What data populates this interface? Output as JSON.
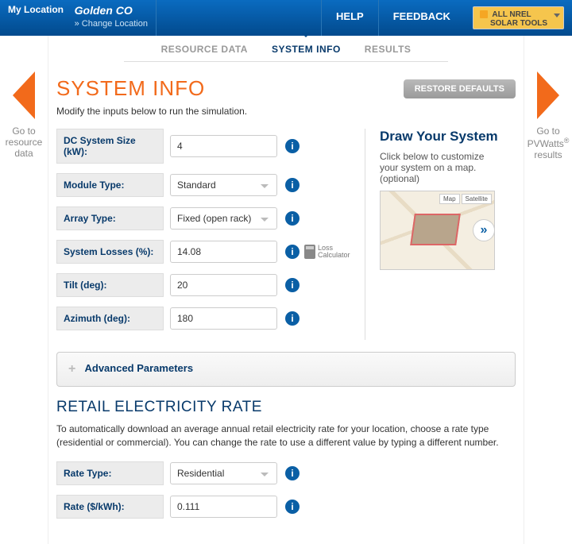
{
  "header": {
    "my_location_label": "My Location",
    "location_value": "Golden CO",
    "change_location": "» Change Location",
    "help": "HELP",
    "feedback": "FEEDBACK",
    "tools_line1": "ALL NREL",
    "tools_line2": "SOLAR TOOLS"
  },
  "tabs": {
    "resource": "RESOURCE DATA",
    "system": "SYSTEM INFO",
    "results": "RESULTS"
  },
  "nav": {
    "left_label1": "Go to",
    "left_label2": "resource",
    "left_label3": "data",
    "right_label1": "Go to",
    "right_label2": "PVWatts",
    "right_label3": "results"
  },
  "page": {
    "title": "SYSTEM INFO",
    "restore": "RESTORE DEFAULTS",
    "subtitle": "Modify the inputs below to run the simulation."
  },
  "form": {
    "dc_label": "DC System Size (kW):",
    "dc_value": "4",
    "module_label": "Module Type:",
    "module_value": "Standard",
    "array_label": "Array Type:",
    "array_value": "Fixed (open rack)",
    "losses_label": "System Losses (%):",
    "losses_value": "14.08",
    "loss_calc": "Loss Calculator",
    "tilt_label": "Tilt (deg):",
    "tilt_value": "20",
    "azimuth_label": "Azimuth (deg):",
    "azimuth_value": "180"
  },
  "side": {
    "title": "Draw Your System",
    "desc": "Click below to customize your system on a map. (optional)",
    "map_tab1": "Map",
    "map_tab2": "Satellite"
  },
  "advanced": {
    "label": "Advanced Parameters"
  },
  "retail": {
    "title": "RETAIL ELECTRICITY RATE",
    "desc": "To automatically download an average annual retail electricity rate for your location, choose a rate type (residential or commercial). You can change the rate to use a different value by typing a different number.",
    "type_label": "Rate Type:",
    "type_value": "Residential",
    "rate_label": "Rate ($/kWh):",
    "rate_value": "0.111"
  }
}
